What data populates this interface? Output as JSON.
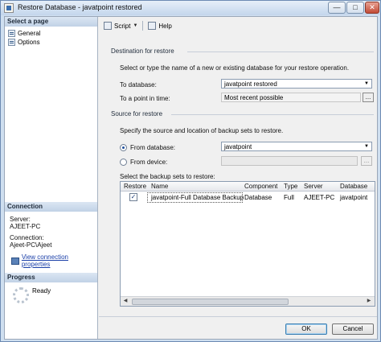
{
  "window": {
    "title": "Restore Database - javatpoint restored",
    "controls": {
      "minimize": "—",
      "maximize": "□",
      "close": "✕"
    }
  },
  "left": {
    "select_page_header": "Select a page",
    "pages": [
      {
        "label": "General",
        "icon": "page-icon"
      },
      {
        "label": "Options",
        "icon": "page-icon"
      }
    ],
    "connection_header": "Connection",
    "server_label": "Server:",
    "server_value": "AJEET-PC",
    "connection_label": "Connection:",
    "connection_value": "Ajeet-PC\\Ajeet",
    "view_properties_link": "View connection properties",
    "progress_header": "Progress",
    "progress_status": "Ready"
  },
  "toolbar": {
    "script_label": "Script",
    "help_label": "Help"
  },
  "destination": {
    "group_label": "Destination for restore",
    "instruction": "Select or type the name of a new or existing database for your restore operation.",
    "to_database_label": "To database:",
    "to_database_value": "javatpoint restored",
    "point_in_time_label": "To a point in time:",
    "point_in_time_value": "Most recent possible"
  },
  "source": {
    "group_label": "Source for restore",
    "instruction": "Specify the source and location of backup sets to restore.",
    "from_database_label": "From database:",
    "from_database_value": "javatpoint",
    "from_device_label": "From device:",
    "from_device_value": "",
    "browse_label": "...",
    "selected": "from_database",
    "select_sets_label": "Select the backup sets to restore:"
  },
  "backup_table": {
    "columns": [
      "Restore",
      "Name",
      "Component",
      "Type",
      "Server",
      "Database"
    ],
    "rows": [
      {
        "restore": true,
        "name": "javatpoint-Full Database Backup",
        "component": "Database",
        "type": "Full",
        "server": "AJEET-PC",
        "database": "javatpoint"
      }
    ]
  },
  "buttons": {
    "ok_label": "OK",
    "cancel_label": "Cancel"
  },
  "colors": {
    "accent": "#1a3fa8",
    "title_bar": "#c4d6ec",
    "close_button": "#c24a35"
  }
}
